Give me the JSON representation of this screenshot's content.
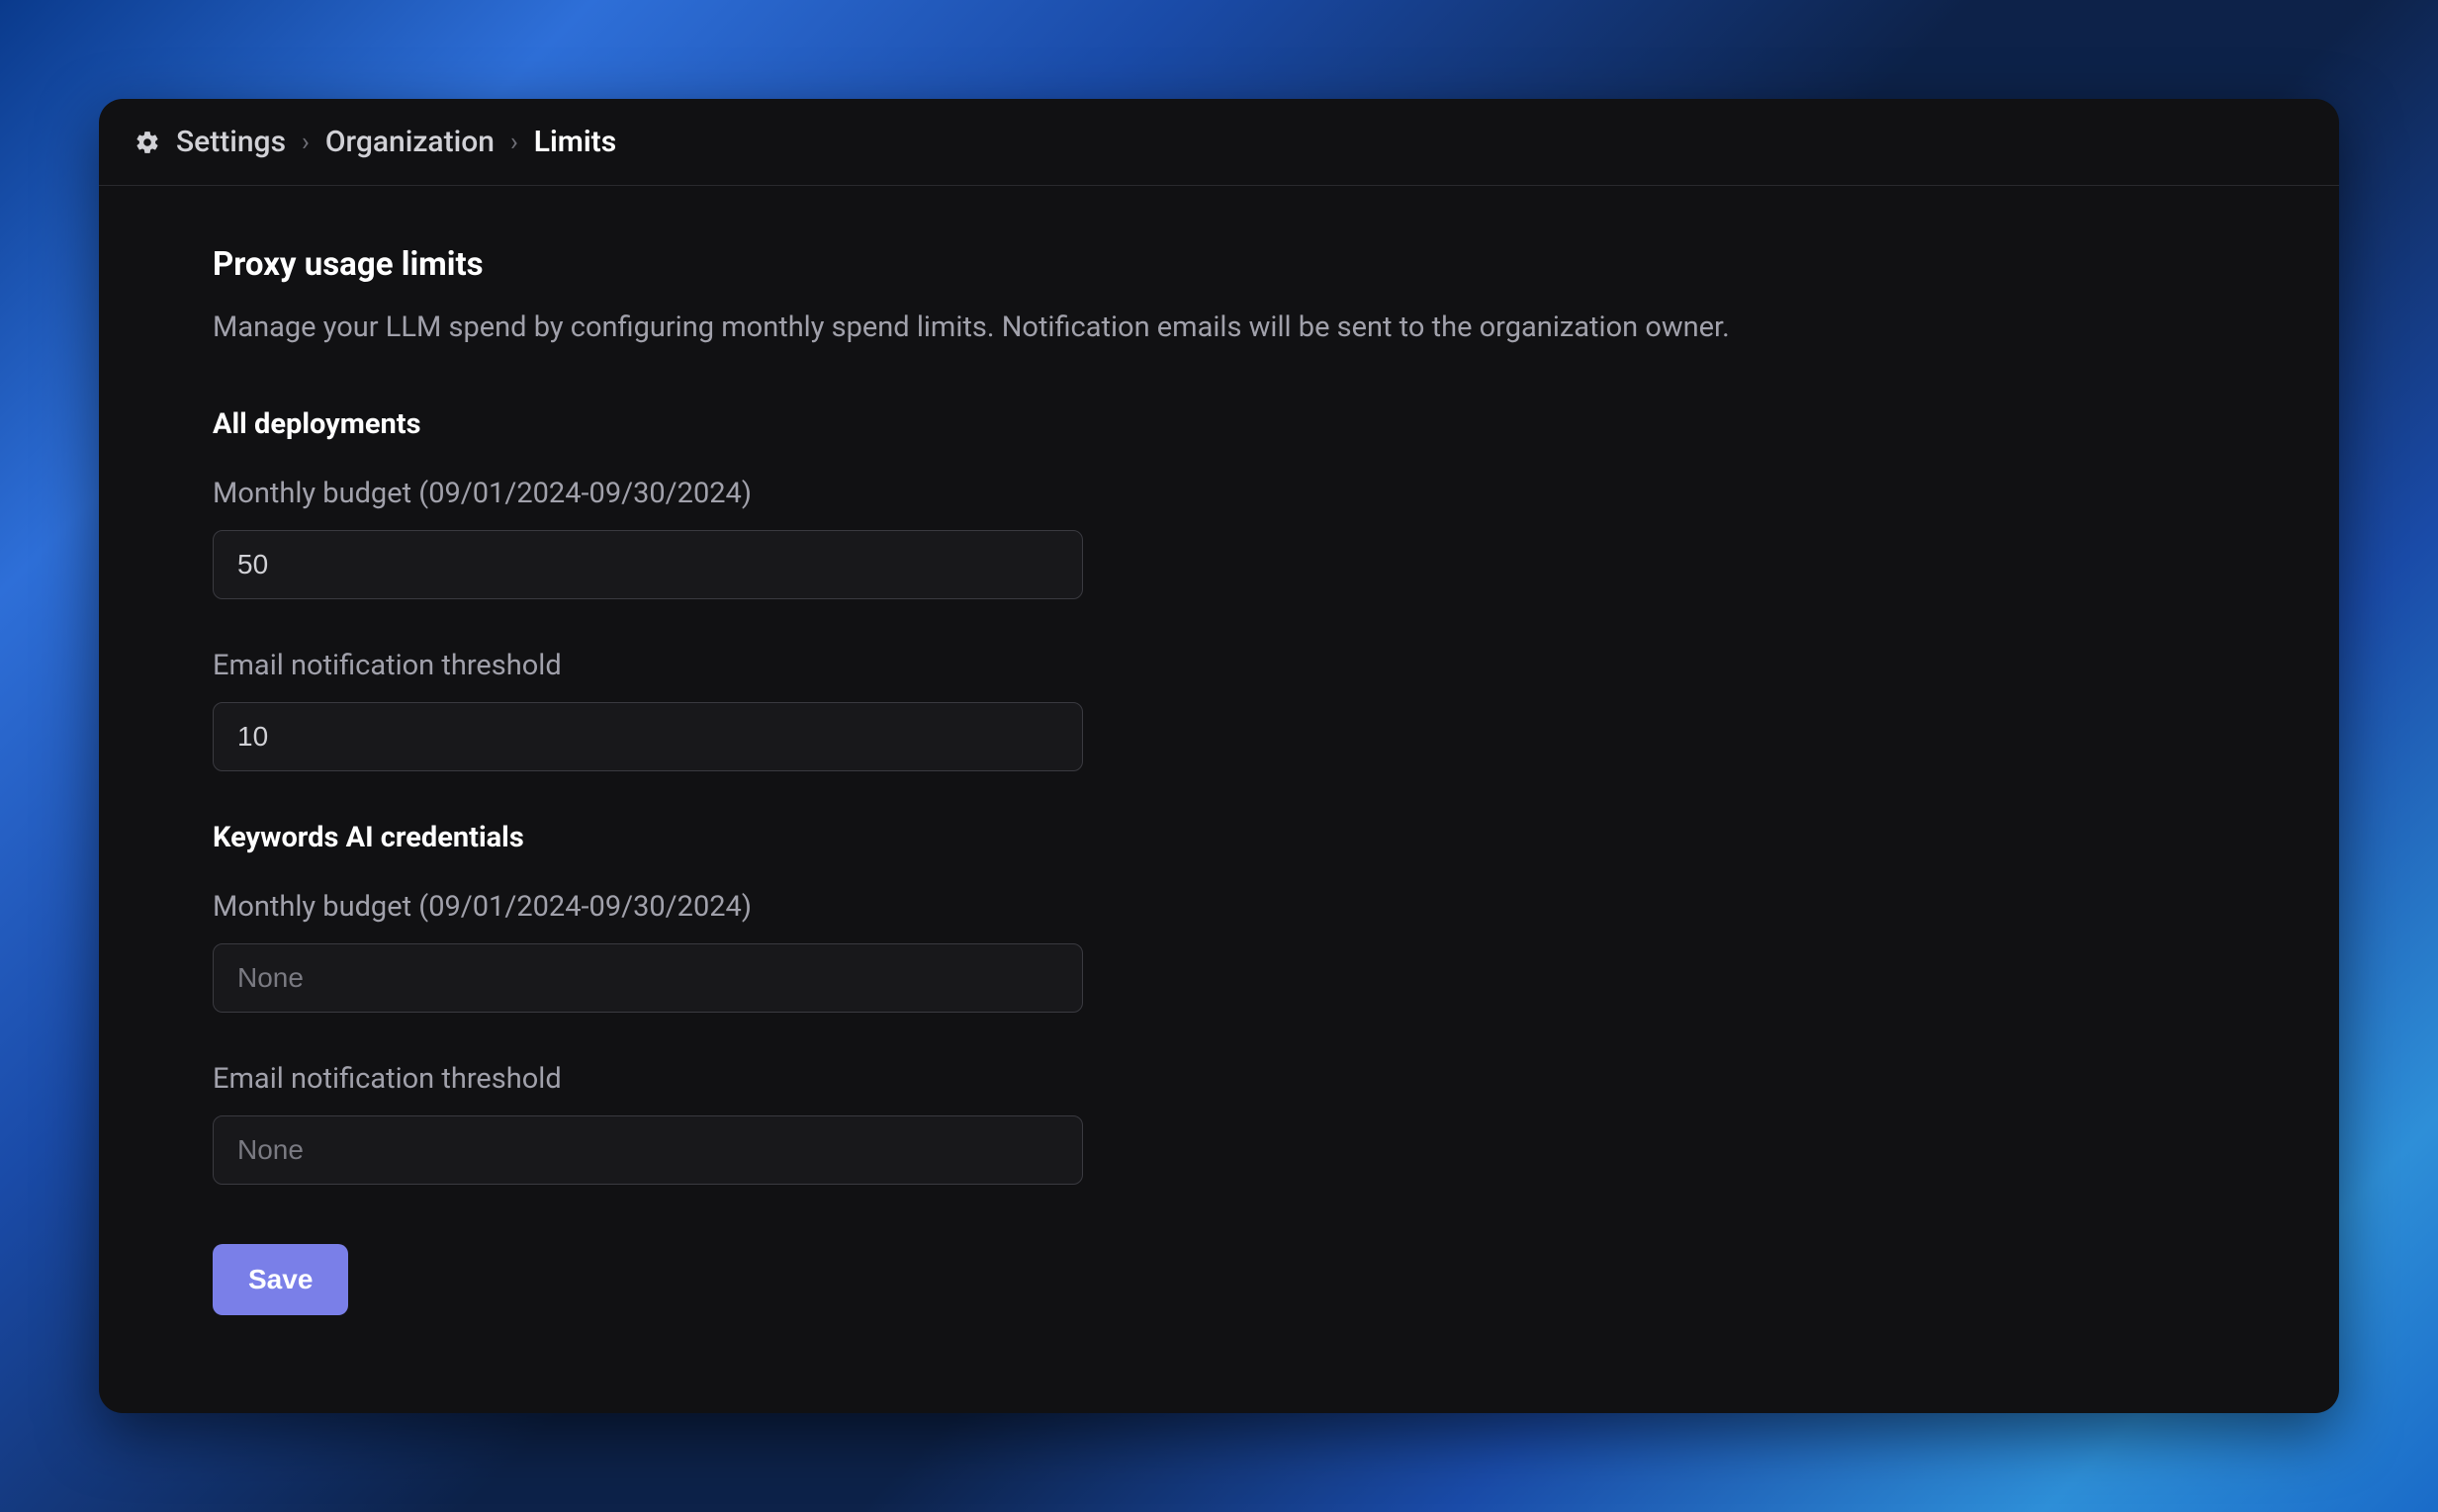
{
  "breadcrumb": {
    "item1": "Settings",
    "item2": "Organization",
    "item3": "Limits"
  },
  "page": {
    "title": "Proxy usage limits",
    "description": "Manage your LLM spend by configuring monthly spend limits. Notification emails will be sent to the organization owner."
  },
  "sections": {
    "all_deployments": {
      "heading": "All deployments",
      "budget_label": "Monthly budget (09/01/2024-09/30/2024)",
      "budget_value": "50",
      "threshold_label": "Email notification threshold",
      "threshold_value": "10"
    },
    "keywords_ai": {
      "heading": "Keywords AI credentials",
      "budget_label": "Monthly budget (09/01/2024-09/30/2024)",
      "budget_placeholder": "None",
      "threshold_label": "Email notification threshold",
      "threshold_placeholder": "None"
    }
  },
  "actions": {
    "save_label": "Save"
  }
}
